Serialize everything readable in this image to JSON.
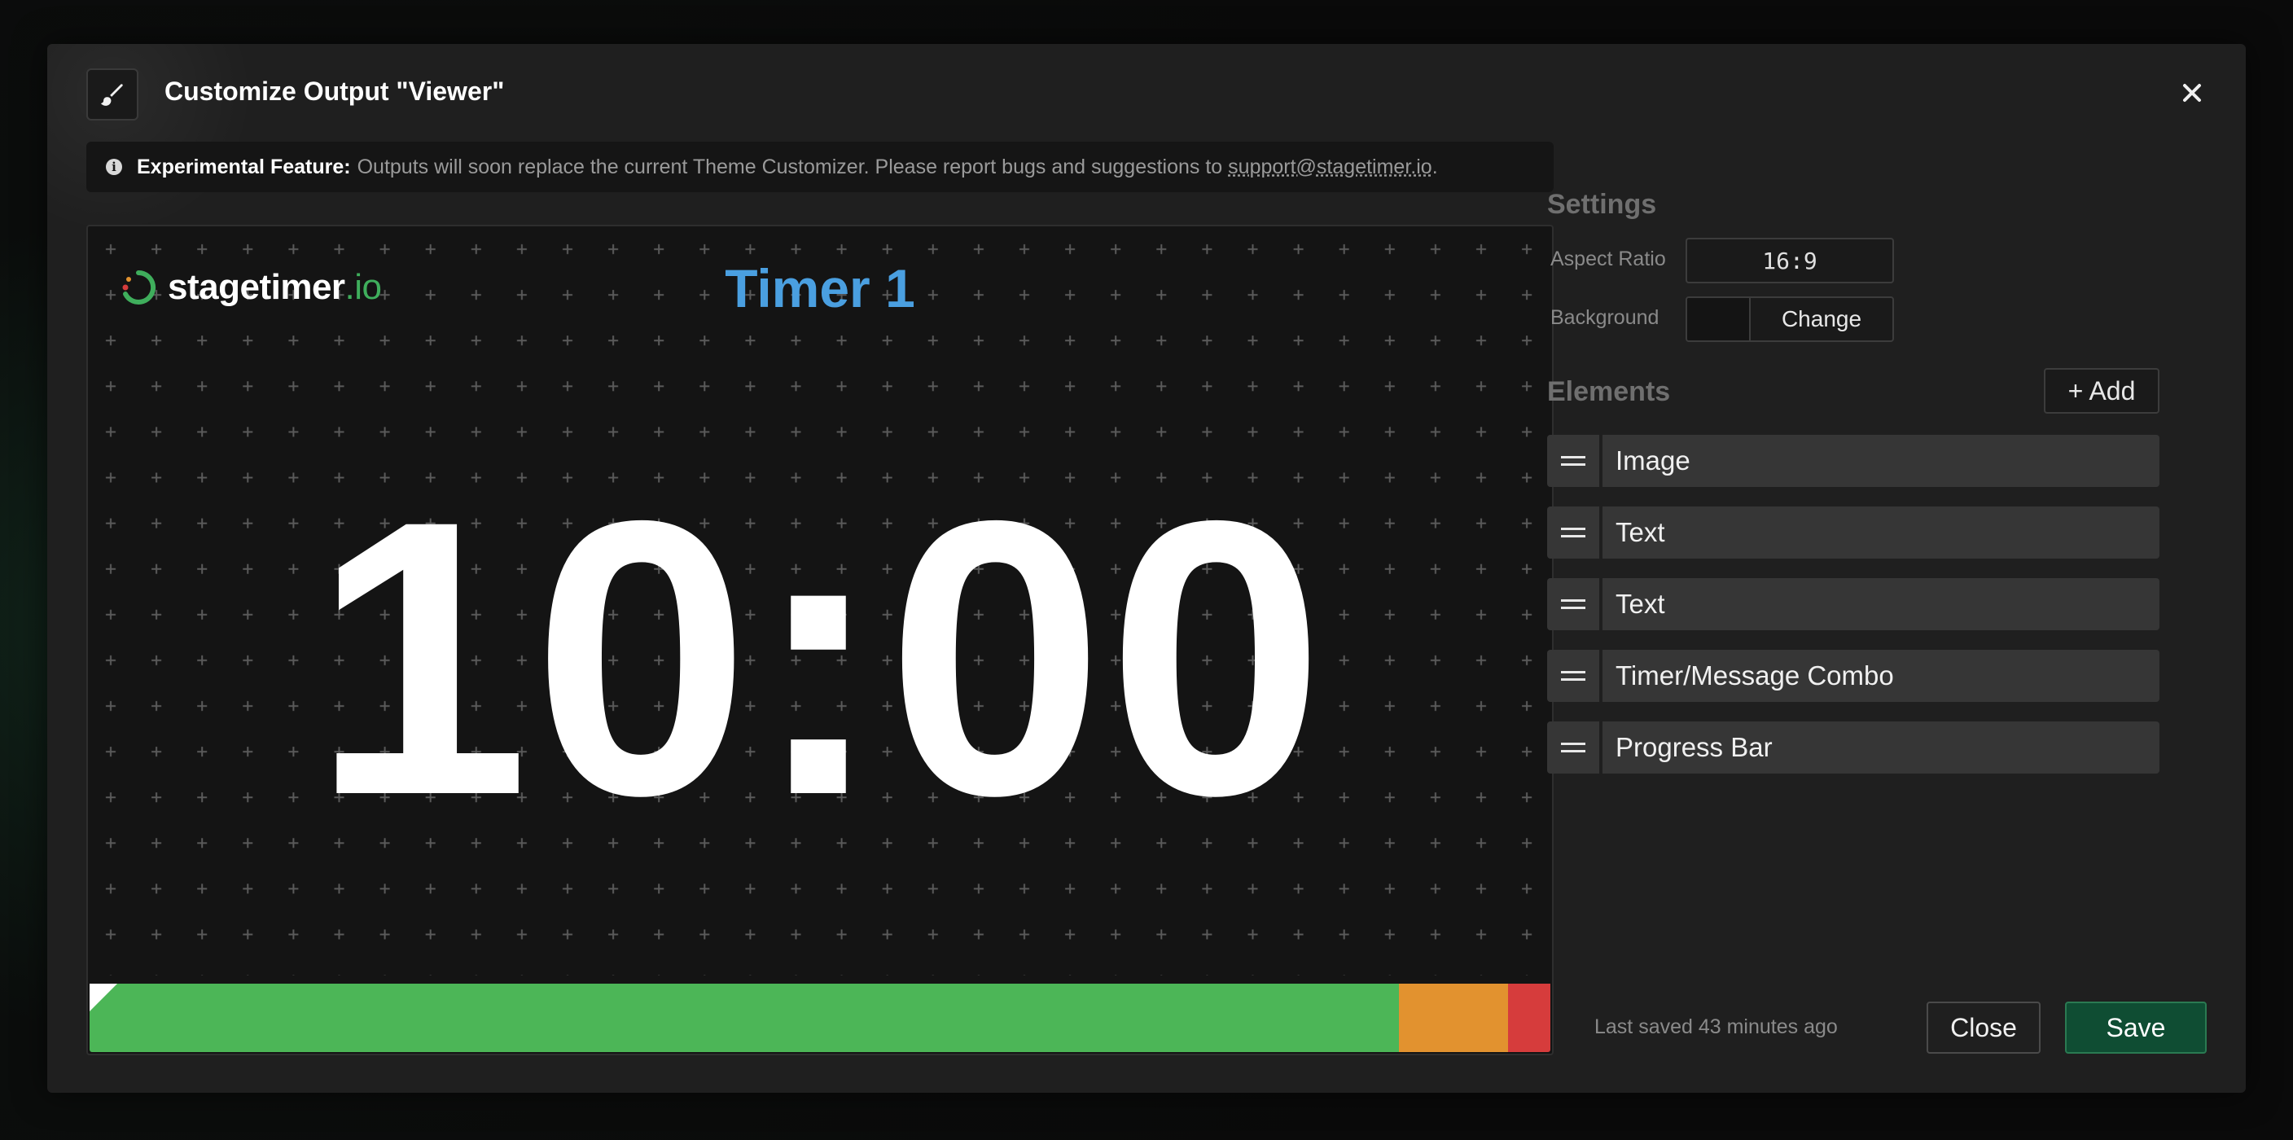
{
  "modal": {
    "title": "Customize Output \"Viewer\"",
    "header_icon": "paintbrush-icon",
    "close_icon": "close-icon"
  },
  "notice": {
    "icon": "info-icon",
    "icon_glyph": "i",
    "label": "Experimental Feature:",
    "text": "Outputs will soon replace the current Theme Customizer. Please report bugs and suggestions to",
    "email": "support@stagetimer.io",
    "trailing": "."
  },
  "preview": {
    "brand_name": "stagetimer",
    "brand_suffix": ".io",
    "timer_name": "Timer 1",
    "time": "10:00",
    "progress": [
      {
        "name": "green",
        "color": "#4cb657",
        "fraction": 0.8965
      },
      {
        "name": "orange",
        "color": "#e2922f",
        "fraction": 0.0745
      },
      {
        "name": "red",
        "color": "#d63c3c",
        "fraction": 0.029
      }
    ],
    "colors": {
      "timer_name": "#4a9fe0",
      "brand_accent": "#3fae5c"
    }
  },
  "settings": {
    "title": "Settings",
    "aspect_ratio_label": "Aspect Ratio",
    "aspect_ratio_value": "16:9",
    "background_label": "Background",
    "background_button": "Change",
    "background_color": "#141414"
  },
  "elements": {
    "title": "Elements",
    "add_label": "+ Add",
    "items": [
      {
        "label": "Image",
        "icon": "drag-handle-icon"
      },
      {
        "label": "Text",
        "icon": "drag-handle-icon"
      },
      {
        "label": "Text",
        "icon": "drag-handle-icon"
      },
      {
        "label": "Timer/Message Combo",
        "icon": "drag-handle-icon"
      },
      {
        "label": "Progress Bar",
        "icon": "drag-handle-icon"
      }
    ]
  },
  "footer": {
    "last_saved": "Last saved 43 minutes ago",
    "close_label": "Close",
    "save_label": "Save",
    "save_color": "#0f4d33"
  }
}
